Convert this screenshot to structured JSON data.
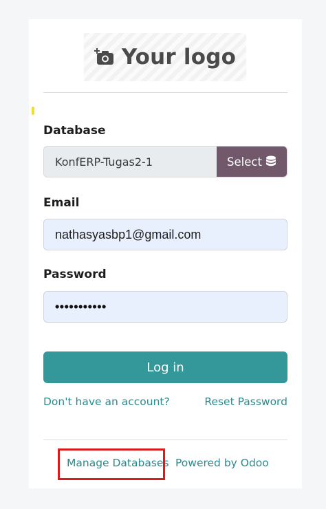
{
  "logo": {
    "text": "Your logo",
    "icon": "camera-plus-icon"
  },
  "database": {
    "label": "Database",
    "value": "KonfERP-Tugas2-1",
    "select_label": "Select",
    "select_icon": "database-icon"
  },
  "email": {
    "label": "Email",
    "value": "nathasyasbp1@gmail.com"
  },
  "password": {
    "label": "Password",
    "masked_value": "•••••••••••"
  },
  "login": {
    "label": "Log in"
  },
  "links": {
    "signup": "Don't have an account?",
    "reset": "Reset Password",
    "manage": "Manage Databases",
    "powered": "Powered by Odoo"
  },
  "colors": {
    "accent": "#34979a",
    "select_button": "#71586b",
    "link": "#2b8a8e",
    "highlight": "#d81b1b",
    "autofill": "#e8f0fe"
  }
}
